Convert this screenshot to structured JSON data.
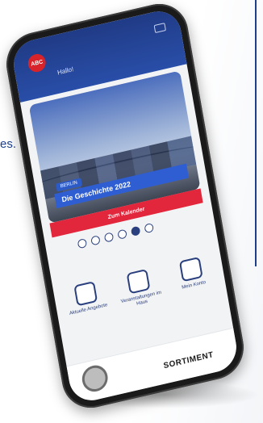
{
  "page": {
    "left_text": "es.",
    "accent_color": "#1d3f8e"
  },
  "app": {
    "logo_label": "ABC",
    "header_title": "Hallo!",
    "hero": {
      "tag": "BERLIN",
      "title": "Die Geschichte 2022",
      "cta": "Zum Kalender"
    },
    "carousel": {
      "count": 6,
      "active_index": 4
    },
    "tiles": [
      {
        "label": "Aktuelle Angebote",
        "icon": "calendar-icon"
      },
      {
        "label": "Veranstaltungen im Haus",
        "icon": "gift-icon"
      },
      {
        "label": "Mein Konto",
        "icon": "cart-icon"
      }
    ],
    "bottom": {
      "label": "SORTIMENT"
    }
  }
}
